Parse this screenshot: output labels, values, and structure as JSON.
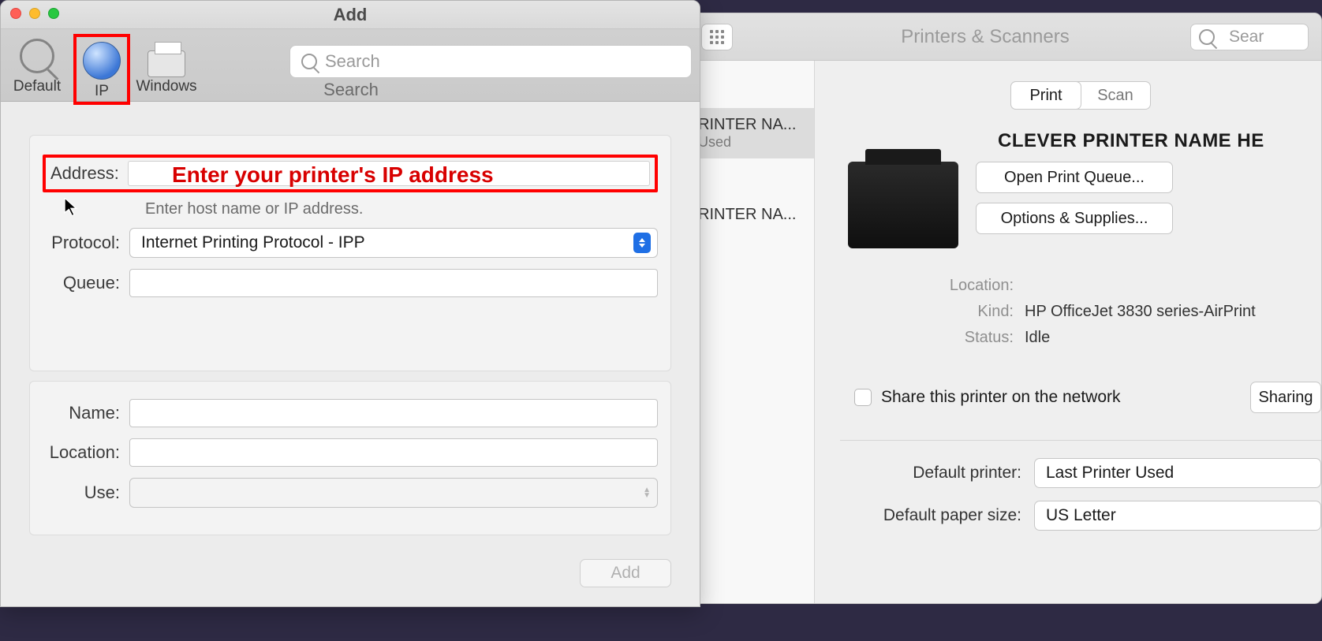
{
  "add_window": {
    "title": "Add",
    "tabs": {
      "default": "Default",
      "ip": "IP",
      "windows": "Windows"
    },
    "search_placeholder": "Search",
    "search_label": "Search",
    "form": {
      "address_label": "Address:",
      "address_annotation": "Enter your printer's IP address",
      "address_hint": "Enter host name or IP address.",
      "protocol_label": "Protocol:",
      "protocol_value": "Internet Printing Protocol - IPP",
      "queue_label": "Queue:",
      "name_label": "Name:",
      "location_label": "Location:",
      "use_label": "Use:"
    },
    "add_button": "Add"
  },
  "ps_window": {
    "title": "Printers & Scanners",
    "search_placeholder": "Sear",
    "sidebar": [
      {
        "title": "RINTER NA...",
        "sub": "Used"
      },
      {
        "title": "RINTER NA...",
        "sub": ""
      }
    ],
    "segmented": {
      "print": "Print",
      "scan": "Scan"
    },
    "printer_name": "CLEVER PRINTER NAME HE",
    "open_queue": "Open Print Queue...",
    "options_supplies": "Options & Supplies...",
    "info": {
      "location_label": "Location:",
      "location_value": "",
      "kind_label": "Kind:",
      "kind_value": "HP OfficeJet 3830 series-AirPrint",
      "status_label": "Status:",
      "status_value": "Idle"
    },
    "share_label": "Share this printer on the network",
    "sharing_button": "Sharing",
    "default_printer_label": "Default printer:",
    "default_printer_value": "Last Printer Used",
    "default_paper_label": "Default paper size:",
    "default_paper_value": "US Letter"
  }
}
